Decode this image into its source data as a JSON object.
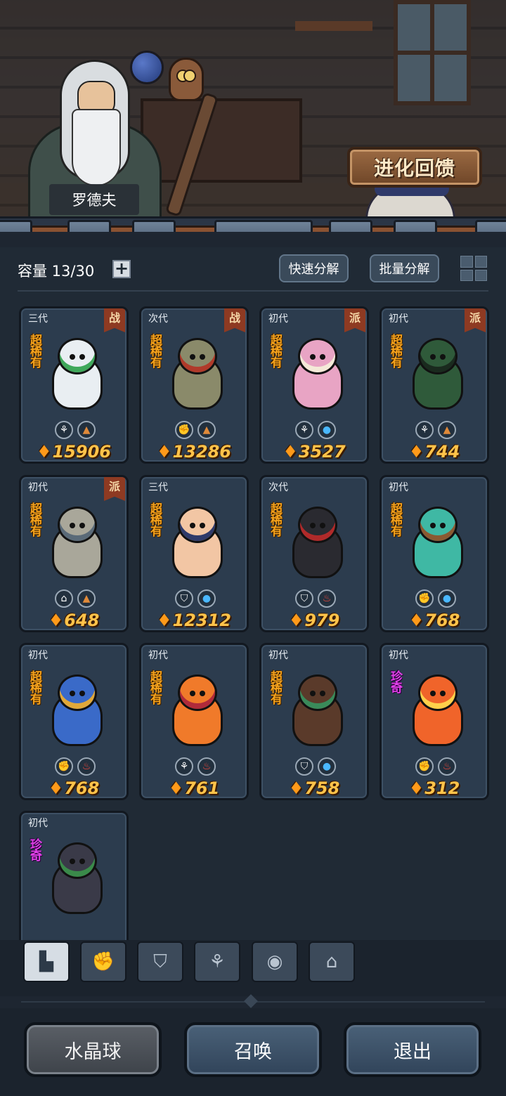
{
  "header": {
    "npc_name": "罗德夫",
    "evolve_button": "进化回馈"
  },
  "toolbar": {
    "capacity_label": "容量 13/30",
    "add_capacity_symbol": "+",
    "quick_decompose": "快速分解",
    "batch_decompose": "批量分解",
    "view_mode_icon": "grid-view-icon"
  },
  "monsters": [
    {
      "gen": "三代",
      "badge": "战",
      "rarity": "超稀有",
      "rarity_class": "ss",
      "traits": [
        "sprout-icon",
        "earth-icon"
      ],
      "power": "15906",
      "color": "#e9eef2",
      "accent": "#3fa85a"
    },
    {
      "gen": "次代",
      "badge": "战",
      "rarity": "超稀有",
      "rarity_class": "ss",
      "traits": [
        "fist-icon",
        "earth-icon"
      ],
      "power": "13286",
      "color": "#8a8a6a",
      "accent": "#b03a2a"
    },
    {
      "gen": "初代",
      "badge": "派",
      "rarity": "超稀有",
      "rarity_class": "ss",
      "traits": [
        "sprout-icon",
        "water-icon"
      ],
      "power": "3527",
      "color": "#e8a4c4",
      "accent": "#f4ead8"
    },
    {
      "gen": "初代",
      "badge": "派",
      "rarity": "超稀有",
      "rarity_class": "ss",
      "traits": [
        "sprout-icon",
        "earth-icon"
      ],
      "power": "744",
      "color": "#2f5a3a",
      "accent": "#1a2a1e"
    },
    {
      "gen": "初代",
      "badge": "派",
      "rarity": "超稀有",
      "rarity_class": "ss",
      "traits": [
        "tower-icon",
        "earth-icon"
      ],
      "power": "648",
      "color": "#a9a79a",
      "accent": "#5a6a78"
    },
    {
      "gen": "三代",
      "badge": "",
      "rarity": "超稀有",
      "rarity_class": "ss",
      "traits": [
        "shield-icon",
        "water-icon"
      ],
      "power": "12312",
      "color": "#f2c6a4",
      "accent": "#2e3a6a"
    },
    {
      "gen": "次代",
      "badge": "",
      "rarity": "超稀有",
      "rarity_class": "ss",
      "traits": [
        "shield-icon",
        "fire-icon"
      ],
      "power": "979",
      "color": "#2a2a30",
      "accent": "#b02a2a"
    },
    {
      "gen": "初代",
      "badge": "",
      "rarity": "超稀有",
      "rarity_class": "ss",
      "traits": [
        "fist-icon",
        "water-icon"
      ],
      "power": "768",
      "color": "#3fb8a4",
      "accent": "#8a5a32"
    },
    {
      "gen": "初代",
      "badge": "",
      "rarity": "超稀有",
      "rarity_class": "ss",
      "traits": [
        "fist-icon",
        "fire-icon"
      ],
      "power": "768",
      "color": "#3a6ac8",
      "accent": "#e0a83a"
    },
    {
      "gen": "初代",
      "badge": "",
      "rarity": "超稀有",
      "rarity_class": "ss",
      "traits": [
        "sprout-icon",
        "fire-icon"
      ],
      "power": "761",
      "color": "#f07a2a",
      "accent": "#b02a3a"
    },
    {
      "gen": "初代",
      "badge": "",
      "rarity": "超稀有",
      "rarity_class": "ss",
      "traits": [
        "shield-icon",
        "water-icon"
      ],
      "power": "758",
      "color": "#5a3a2a",
      "accent": "#3a8a5a"
    },
    {
      "gen": "初代",
      "badge": "",
      "rarity": "珍奇",
      "rarity_class": "rare",
      "traits": [
        "fist-icon",
        "fire-icon"
      ],
      "power": "312",
      "color": "#f0642a",
      "accent": "#ffd04a"
    },
    {
      "gen": "初代",
      "badge": "",
      "rarity": "珍奇",
      "rarity_class": "rare",
      "traits": [],
      "power": "",
      "color": "#3a3a48",
      "accent": "#3a8a4a"
    }
  ],
  "filter_tabs": [
    {
      "icon": "all-blocks-icon",
      "glyph": "▙",
      "active": true
    },
    {
      "icon": "fist-icon",
      "glyph": "✊",
      "active": false
    },
    {
      "icon": "shield-icon",
      "glyph": "⛉",
      "active": false
    },
    {
      "icon": "sprout-icon",
      "glyph": "⚘",
      "active": false
    },
    {
      "icon": "spirit-icon",
      "glyph": "◉",
      "active": false
    },
    {
      "icon": "tower-icon",
      "glyph": "⌂",
      "active": false
    }
  ],
  "bottom_buttons": {
    "crystal_ball": "水晶球",
    "summon": "召唤",
    "exit": "退出"
  }
}
